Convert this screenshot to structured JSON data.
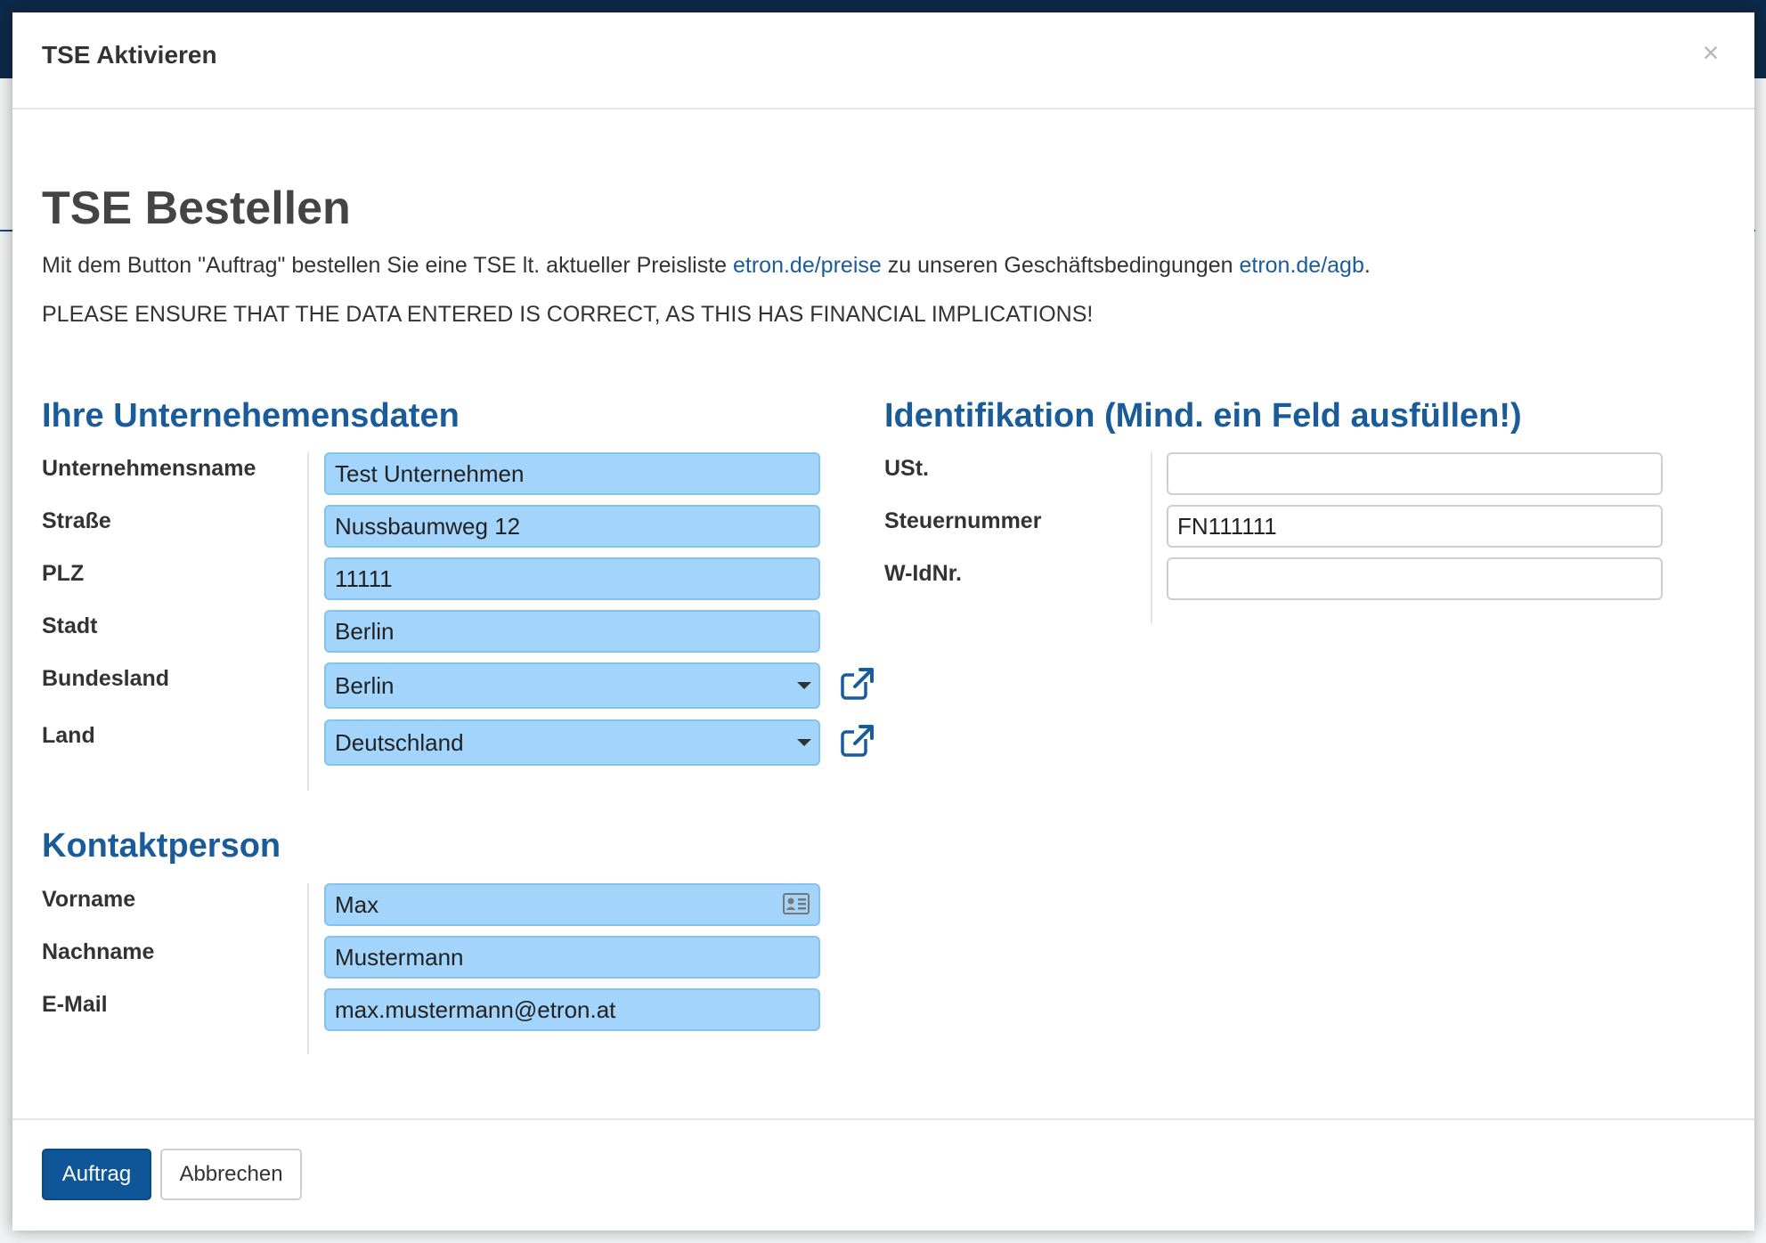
{
  "modal": {
    "title": "TSE Aktivieren",
    "close_label": "×"
  },
  "content": {
    "heading": "TSE Bestellen",
    "intro_before": "Mit dem Button \"Auftrag\" bestellen Sie eine TSE lt. aktueller Preisliste ",
    "link_prices": "etron.de/preise",
    "intro_middle": " zu unseren Geschäftsbedingungen ",
    "link_agb": "etron.de/agb",
    "intro_after": ".",
    "warning": "PLEASE ENSURE THAT THE DATA ENTERED IS CORRECT, AS THIS HAS FINANCIAL IMPLICATIONS!"
  },
  "company": {
    "title": "Ihre Unternehemensdaten",
    "fields": [
      {
        "label": "Unternehmensname",
        "value": "Test Unternehmen"
      },
      {
        "label": "Straße",
        "value": "Nussbaumweg 12"
      },
      {
        "label": "PLZ",
        "value": "11111"
      },
      {
        "label": "Stadt",
        "value": "Berlin"
      },
      {
        "label": "Bundesland",
        "value": "Berlin"
      },
      {
        "label": "Land",
        "value": "Deutschland"
      }
    ]
  },
  "identification": {
    "title": "Identifikation (Mind. ein Feld ausfüllen!)",
    "fields": [
      {
        "label": "USt.",
        "value": ""
      },
      {
        "label": "Steuernummer",
        "value": "FN111111"
      },
      {
        "label": "W-IdNr.",
        "value": ""
      }
    ]
  },
  "contact": {
    "title": "Kontaktperson",
    "fields": [
      {
        "label": "Vorname",
        "value": "Max"
      },
      {
        "label": "Nachname",
        "value": "Mustermann"
      },
      {
        "label": "E-Mail",
        "value": "max.mustermann@etron.at"
      }
    ]
  },
  "footer": {
    "primary_label": "Auftrag",
    "secondary_label": "Abbrechen"
  },
  "colors": {
    "accent": "#1a5c9a",
    "primary_button": "#0f5698",
    "filled_field": "#a3d4fb",
    "link": "#1b5c99"
  }
}
